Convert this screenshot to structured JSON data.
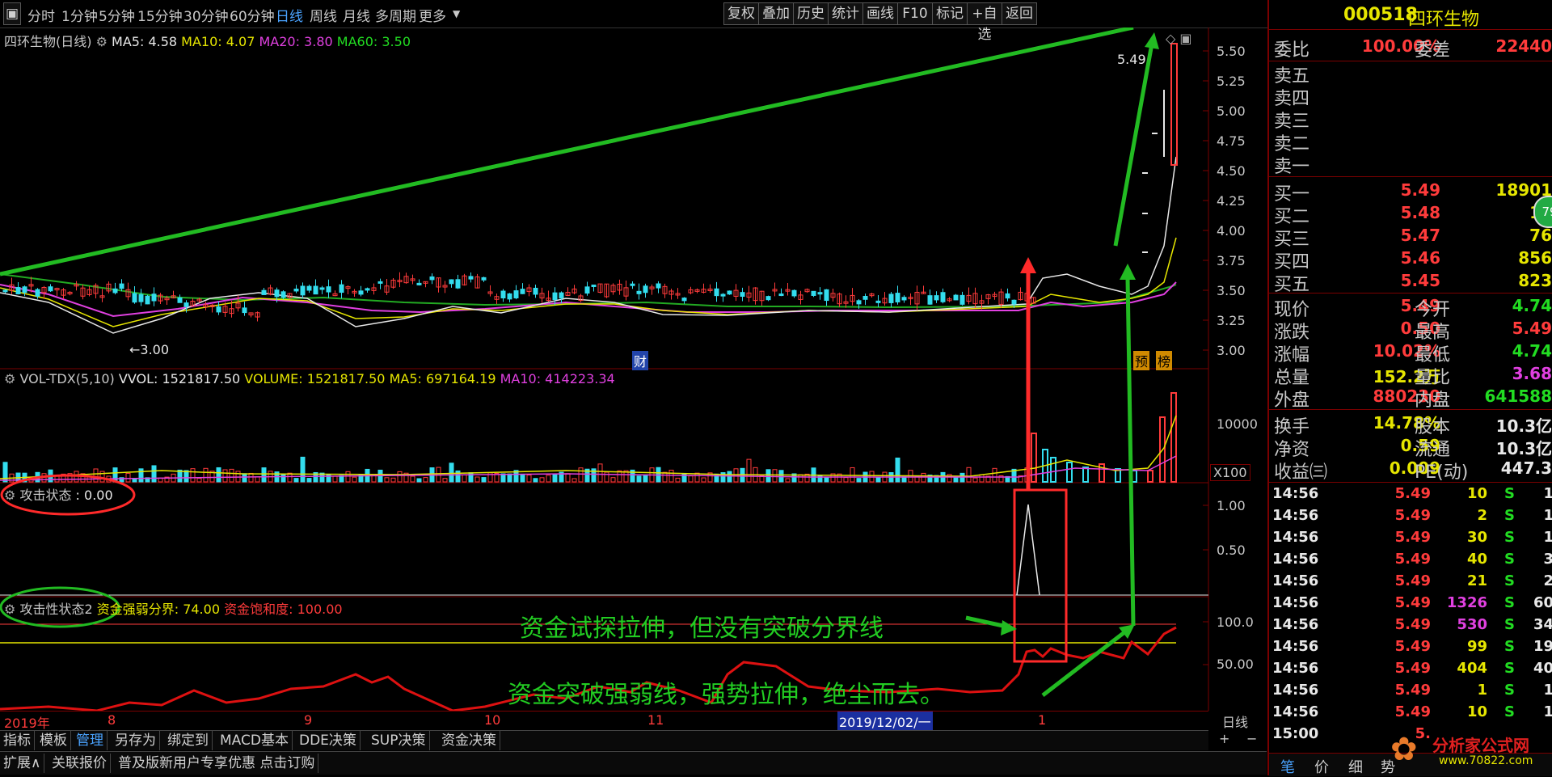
{
  "toolbar": {
    "periods": [
      "分时",
      "1分钟",
      "5分钟",
      "15分钟",
      "30分钟",
      "60分钟",
      "日线",
      "周线",
      "月线",
      "多周期",
      "更多"
    ],
    "active_period": "日线",
    "right_buttons": [
      "复权",
      "叠加",
      "历史",
      "统计",
      "画线",
      "F10",
      "标记",
      "+自选",
      "返回"
    ]
  },
  "main_panel": {
    "title": "四环生物(日线)",
    "ma5": "MA5: 4.58",
    "ma10": "MA10: 4.07",
    "ma20": "MA20: 3.80",
    "ma60": "MA60: 3.50",
    "high_marker": "5.49",
    "low_marker": "3.00",
    "fin_tag": "财",
    "tag_yu": "预",
    "tag_bang": "榜",
    "y_ticks": [
      "5.50",
      "5.25",
      "5.00",
      "4.75",
      "4.50",
      "4.25",
      "4.00",
      "3.75",
      "3.50",
      "3.25",
      "3.00"
    ]
  },
  "vol_panel": {
    "name": "VOL-TDX(5,10)",
    "vvol": "VVOL: 1521817.50",
    "volume": "VOLUME: 1521817.50",
    "ma5": "MA5: 697164.19",
    "ma10": "MA10: 414223.34",
    "y_tick": "10000",
    "unit": "X100"
  },
  "atk1_panel": {
    "name": "攻击状态",
    "value": ": 0.00",
    "y_ticks": [
      "1.00",
      "0.50"
    ]
  },
  "atk2_panel": {
    "name": "攻击性状态2",
    "boundary": "资金强弱分界: 74.00",
    "saturation": "资金饱和度: 100.00",
    "y_ticks": [
      "100.0",
      "50.00"
    ]
  },
  "annotations": {
    "text1": "资金试探拉伸，但没有突破分界线",
    "text2": "资金突破强弱线，强势拉伸，绝尘而去。"
  },
  "time_axis": {
    "labels": [
      "2019年",
      "8",
      "9",
      "10",
      "11",
      "2019/12/02/一",
      "1"
    ],
    "period_label": "日线"
  },
  "bottom_tabs_row1": [
    "指标",
    "模板",
    "管理",
    "另存为",
    "绑定到",
    "MACD基本",
    "DDE决策",
    "SUP决策",
    "资金决策"
  ],
  "bottom_tabs_row2": [
    "扩展∧",
    "关联报价",
    "普及版新用户专享优惠 点击订购"
  ],
  "zoom_buttons": [
    "+",
    "−"
  ],
  "quote": {
    "code": "000518",
    "name": "四环生物",
    "weibi_label": "委比",
    "weibi": "100.00%",
    "weicha_label": "委差",
    "weicha": "22440",
    "sells": [
      "卖五",
      "卖四",
      "卖三",
      "卖二",
      "卖一"
    ],
    "buys": [
      {
        "label": "买一",
        "price": "5.49",
        "vol": "18901"
      },
      {
        "label": "买二",
        "price": "5.48",
        "vol": "10"
      },
      {
        "label": "买三",
        "price": "5.47",
        "vol": "76"
      },
      {
        "label": "买四",
        "price": "5.46",
        "vol": "856"
      },
      {
        "label": "买五",
        "price": "5.45",
        "vol": "823"
      }
    ],
    "stats_left": [
      {
        "label": "现价",
        "value": "5.49"
      },
      {
        "label": "涨跌",
        "value": "0.50"
      },
      {
        "label": "涨幅",
        "value": "10.02%"
      },
      {
        "label": "总量",
        "value": "152.2万"
      },
      {
        "label": "外盘",
        "value": "880230"
      }
    ],
    "stats_right": [
      {
        "label": "今开",
        "value": "4.74"
      },
      {
        "label": "最高",
        "value": "5.49"
      },
      {
        "label": "最低",
        "value": "4.74"
      },
      {
        "label": "量比",
        "value": "3.68"
      },
      {
        "label": "内盘",
        "value": "641588"
      }
    ],
    "extra_left": [
      {
        "label": "换手",
        "value": "14.78%"
      },
      {
        "label": "净资",
        "value": "0.59"
      },
      {
        "label": "收益㈢",
        "value": "0.009"
      }
    ],
    "extra_right": [
      {
        "label": "股本",
        "value": "10.3亿"
      },
      {
        "label": "流通",
        "value": "10.3亿"
      },
      {
        "label": "PE(动)",
        "value": "447.3"
      }
    ],
    "ticks": [
      {
        "t": "14:56",
        "p": "5.49",
        "v": "10",
        "s": "S",
        "n": "1"
      },
      {
        "t": "14:56",
        "p": "5.49",
        "v": "2",
        "s": "S",
        "n": "1"
      },
      {
        "t": "14:56",
        "p": "5.49",
        "v": "30",
        "s": "S",
        "n": "1"
      },
      {
        "t": "14:56",
        "p": "5.49",
        "v": "40",
        "s": "S",
        "n": "3"
      },
      {
        "t": "14:56",
        "p": "5.49",
        "v": "21",
        "s": "S",
        "n": "2"
      },
      {
        "t": "14:56",
        "p": "5.49",
        "v": "1326",
        "s": "S",
        "n": "60"
      },
      {
        "t": "14:56",
        "p": "5.49",
        "v": "530",
        "s": "S",
        "n": "34"
      },
      {
        "t": "14:56",
        "p": "5.49",
        "v": "99",
        "s": "S",
        "n": "19"
      },
      {
        "t": "14:56",
        "p": "5.49",
        "v": "404",
        "s": "S",
        "n": "40"
      },
      {
        "t": "14:56",
        "p": "5.49",
        "v": "1",
        "s": "S",
        "n": "1"
      },
      {
        "t": "14:56",
        "p": "5.49",
        "v": "10",
        "s": "S",
        "n": "1"
      },
      {
        "t": "15:00",
        "p": "5.",
        "v": "",
        "s": "",
        "n": ""
      }
    ],
    "badge": "79",
    "bottom_tabs": [
      "笔",
      "价",
      "细",
      "势"
    ],
    "logo_text": "分析家公式网",
    "logo_url": "www.70822.com"
  }
}
